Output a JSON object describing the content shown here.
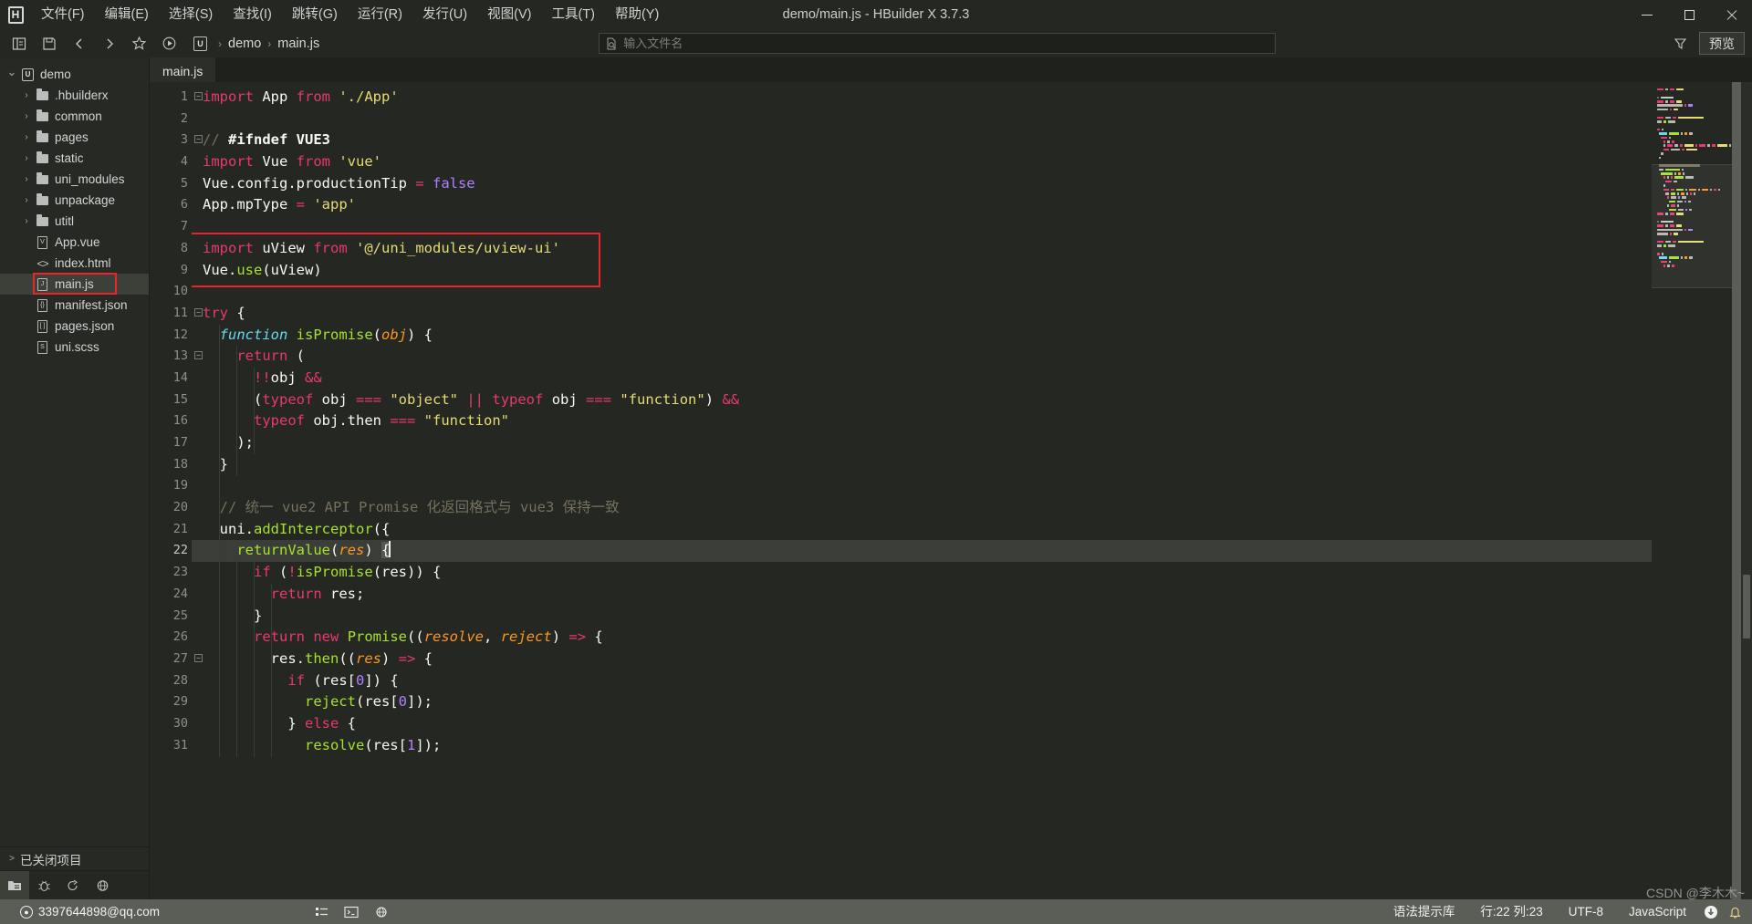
{
  "window": {
    "title": "demo/main.js - HBuilder X 3.7.3",
    "logo": "H",
    "minimize": "minimize-icon",
    "maximize": "maximize-icon",
    "close": "close-icon"
  },
  "menubar": [
    {
      "label": "文件(F)"
    },
    {
      "label": "编辑(E)"
    },
    {
      "label": "选择(S)"
    },
    {
      "label": "查找(I)"
    },
    {
      "label": "跳转(G)"
    },
    {
      "label": "运行(R)"
    },
    {
      "label": "发行(U)"
    },
    {
      "label": "视图(V)"
    },
    {
      "label": "工具(T)"
    },
    {
      "label": "帮助(Y)"
    }
  ],
  "toolbar": {
    "buttons": [
      "toggle-sidebar-icon",
      "save-icon",
      "back-icon",
      "forward-icon",
      "favorite-icon",
      "run-icon"
    ],
    "breadcrumb": {
      "project_badge": "U",
      "project": "demo",
      "separator": "›",
      "file": "main.js"
    },
    "search": {
      "placeholder": "输入文件名",
      "value": "",
      "icon": "file-search-icon"
    },
    "filter_icon": "filter-icon",
    "preview_label": "预览"
  },
  "sidebar": {
    "tree": [
      {
        "label": "demo",
        "indent": 0,
        "twisty": "v",
        "icon": "project-icon",
        "badge": "U",
        "selected": false
      },
      {
        "label": ".hbuilderx",
        "indent": 1,
        "twisty": ">",
        "icon": "folder-icon",
        "selected": false
      },
      {
        "label": "common",
        "indent": 1,
        "twisty": ">",
        "icon": "folder-icon",
        "selected": false
      },
      {
        "label": "pages",
        "indent": 1,
        "twisty": ">",
        "icon": "folder-icon",
        "selected": false
      },
      {
        "label": "static",
        "indent": 1,
        "twisty": ">",
        "icon": "folder-icon",
        "selected": false
      },
      {
        "label": "uni_modules",
        "indent": 1,
        "twisty": ">",
        "icon": "folder-icon",
        "selected": false
      },
      {
        "label": "unpackage",
        "indent": 1,
        "twisty": ">",
        "icon": "folder-icon",
        "selected": false
      },
      {
        "label": "utitl",
        "indent": 1,
        "twisty": ">",
        "icon": "folder-icon",
        "selected": false
      },
      {
        "label": "App.vue",
        "indent": 1,
        "twisty": "",
        "icon": "vue-file-icon",
        "badge": "V",
        "selected": false
      },
      {
        "label": "index.html",
        "indent": 1,
        "twisty": "",
        "icon": "html-file-icon",
        "badge": "<>",
        "selected": false
      },
      {
        "label": "main.js",
        "indent": 1,
        "twisty": "",
        "icon": "js-file-icon",
        "badge": "J",
        "selected": true,
        "highlighted": true
      },
      {
        "label": "manifest.json",
        "indent": 1,
        "twisty": "",
        "icon": "json-file-icon",
        "badge": "{}",
        "selected": false
      },
      {
        "label": "pages.json",
        "indent": 1,
        "twisty": "",
        "icon": "json-file-icon",
        "badge": "[ ]",
        "selected": false
      },
      {
        "label": "uni.scss",
        "indent": 1,
        "twisty": "",
        "icon": "scss-file-icon",
        "badge": "S",
        "selected": false
      }
    ],
    "closed_projects": {
      "label": "已关闭项目",
      "twisty": ">"
    },
    "bottom_tools": [
      "explorer-icon",
      "debug-icon",
      "share-icon",
      "network-icon"
    ]
  },
  "editor": {
    "tabs": [
      {
        "label": "main.js",
        "active": true
      }
    ],
    "current_line": 22,
    "first_line": 1,
    "red_highlight_lines": [
      8,
      9
    ],
    "lines": [
      {
        "n": 1,
        "fold": "-",
        "tokens": [
          {
            "t": "import",
            "c": "t-kw"
          },
          {
            "t": " App ",
            "c": "t-def"
          },
          {
            "t": "from",
            "c": "t-kw"
          },
          {
            "t": " ",
            "c": "t-def"
          },
          {
            "t": "'./App'",
            "c": "t-str"
          }
        ]
      },
      {
        "n": 2,
        "fold": "",
        "tokens": []
      },
      {
        "n": 3,
        "fold": "-",
        "tokens": [
          {
            "t": "// ",
            "c": "t-com"
          },
          {
            "t": "#ifndef VUE3",
            "c": "t-pp"
          }
        ]
      },
      {
        "n": 4,
        "fold": "",
        "tokens": [
          {
            "t": "import",
            "c": "t-kw"
          },
          {
            "t": " Vue ",
            "c": "t-def"
          },
          {
            "t": "from",
            "c": "t-kw"
          },
          {
            "t": " ",
            "c": "t-def"
          },
          {
            "t": "'vue'",
            "c": "t-str"
          }
        ]
      },
      {
        "n": 5,
        "fold": "",
        "tokens": [
          {
            "t": "Vue.config.productionTip ",
            "c": "t-def"
          },
          {
            "t": "=",
            "c": "t-op"
          },
          {
            "t": " ",
            "c": "t-def"
          },
          {
            "t": "false",
            "c": "t-const"
          }
        ]
      },
      {
        "n": 6,
        "fold": "",
        "tokens": [
          {
            "t": "App.mpType ",
            "c": "t-def"
          },
          {
            "t": "=",
            "c": "t-op"
          },
          {
            "t": " ",
            "c": "t-def"
          },
          {
            "t": "'app'",
            "c": "t-str"
          }
        ]
      },
      {
        "n": 7,
        "fold": "",
        "tokens": []
      },
      {
        "n": 8,
        "fold": "",
        "tokens": [
          {
            "t": "import",
            "c": "t-kw"
          },
          {
            "t": " uView ",
            "c": "t-def"
          },
          {
            "t": "from",
            "c": "t-kw"
          },
          {
            "t": " ",
            "c": "t-def"
          },
          {
            "t": "'@/uni_modules/uview-ui'",
            "c": "t-str"
          }
        ]
      },
      {
        "n": 9,
        "fold": "",
        "tokens": [
          {
            "t": "Vue.",
            "c": "t-def"
          },
          {
            "t": "use",
            "c": "t-fn"
          },
          {
            "t": "(uView)",
            "c": "t-def"
          }
        ]
      },
      {
        "n": 10,
        "fold": "",
        "tokens": []
      },
      {
        "n": 11,
        "fold": "-",
        "tokens": [
          {
            "t": "try",
            "c": "t-kw"
          },
          {
            "t": " {",
            "c": "t-def"
          }
        ]
      },
      {
        "n": 12,
        "fold": "",
        "tokens": [
          {
            "t": "  ",
            "c": "t-def"
          },
          {
            "t": "function",
            "c": "t-type"
          },
          {
            "t": " ",
            "c": "t-def"
          },
          {
            "t": "isPromise",
            "c": "t-fn"
          },
          {
            "t": "(",
            "c": "t-def"
          },
          {
            "t": "obj",
            "c": "t-param"
          },
          {
            "t": ") {",
            "c": "t-def"
          }
        ]
      },
      {
        "n": 13,
        "fold": "-",
        "tokens": [
          {
            "t": "    ",
            "c": "t-def"
          },
          {
            "t": "return",
            "c": "t-kw"
          },
          {
            "t": " (",
            "c": "t-def"
          }
        ]
      },
      {
        "n": 14,
        "fold": "",
        "tokens": [
          {
            "t": "      ",
            "c": "t-def"
          },
          {
            "t": "!!",
            "c": "t-op"
          },
          {
            "t": "obj ",
            "c": "t-def"
          },
          {
            "t": "&&",
            "c": "t-op"
          }
        ]
      },
      {
        "n": 15,
        "fold": "",
        "tokens": [
          {
            "t": "      (",
            "c": "t-def"
          },
          {
            "t": "typeof",
            "c": "t-op"
          },
          {
            "t": " obj ",
            "c": "t-def"
          },
          {
            "t": "===",
            "c": "t-op"
          },
          {
            "t": " ",
            "c": "t-def"
          },
          {
            "t": "\"object\"",
            "c": "t-str"
          },
          {
            "t": " ",
            "c": "t-def"
          },
          {
            "t": "||",
            "c": "t-op"
          },
          {
            "t": " ",
            "c": "t-def"
          },
          {
            "t": "typeof",
            "c": "t-op"
          },
          {
            "t": " obj ",
            "c": "t-def"
          },
          {
            "t": "===",
            "c": "t-op"
          },
          {
            "t": " ",
            "c": "t-def"
          },
          {
            "t": "\"function\"",
            "c": "t-str"
          },
          {
            "t": ") ",
            "c": "t-def"
          },
          {
            "t": "&&",
            "c": "t-op"
          }
        ]
      },
      {
        "n": 16,
        "fold": "",
        "tokens": [
          {
            "t": "      ",
            "c": "t-def"
          },
          {
            "t": "typeof",
            "c": "t-op"
          },
          {
            "t": " obj.then ",
            "c": "t-def"
          },
          {
            "t": "===",
            "c": "t-op"
          },
          {
            "t": " ",
            "c": "t-def"
          },
          {
            "t": "\"function\"",
            "c": "t-str"
          }
        ]
      },
      {
        "n": 17,
        "fold": "",
        "tokens": [
          {
            "t": "    );",
            "c": "t-def"
          }
        ]
      },
      {
        "n": 18,
        "fold": "",
        "tokens": [
          {
            "t": "  }",
            "c": "t-def"
          }
        ]
      },
      {
        "n": 19,
        "fold": "",
        "tokens": []
      },
      {
        "n": 20,
        "fold": "",
        "tokens": [
          {
            "t": "  // 统一 vue2 API Promise 化返回格式与 vue3 保持一致",
            "c": "t-com"
          }
        ]
      },
      {
        "n": 21,
        "fold": "",
        "tokens": [
          {
            "t": "  uni.",
            "c": "t-def"
          },
          {
            "t": "addInterceptor",
            "c": "t-fn"
          },
          {
            "t": "({",
            "c": "t-def"
          }
        ]
      },
      {
        "n": 22,
        "fold": "-",
        "tokens": [
          {
            "t": "    ",
            "c": "t-def"
          },
          {
            "t": "returnValue",
            "c": "t-fn"
          },
          {
            "t": "(",
            "c": "t-def"
          },
          {
            "t": "res",
            "c": "t-param"
          },
          {
            "t": ") ",
            "c": "t-def"
          }
        ],
        "caret_after_brace": true
      },
      {
        "n": 23,
        "fold": "",
        "tokens": [
          {
            "t": "      ",
            "c": "t-def"
          },
          {
            "t": "if",
            "c": "t-kw"
          },
          {
            "t": " (",
            "c": "t-def"
          },
          {
            "t": "!",
            "c": "t-op"
          },
          {
            "t": "isPromise",
            "c": "t-fn"
          },
          {
            "t": "(res)) {",
            "c": "t-def"
          }
        ]
      },
      {
        "n": 24,
        "fold": "",
        "tokens": [
          {
            "t": "        ",
            "c": "t-def"
          },
          {
            "t": "return",
            "c": "t-kw"
          },
          {
            "t": " res;",
            "c": "t-def"
          }
        ]
      },
      {
        "n": 25,
        "fold": "",
        "tokens": [
          {
            "t": "      }",
            "c": "t-def"
          }
        ]
      },
      {
        "n": 26,
        "fold": "",
        "tokens": [
          {
            "t": "      ",
            "c": "t-def"
          },
          {
            "t": "return",
            "c": "t-kw"
          },
          {
            "t": " ",
            "c": "t-def"
          },
          {
            "t": "new",
            "c": "t-kw"
          },
          {
            "t": " ",
            "c": "t-def"
          },
          {
            "t": "Promise",
            "c": "t-fn"
          },
          {
            "t": "((",
            "c": "t-def"
          },
          {
            "t": "resolve",
            "c": "t-param"
          },
          {
            "t": ", ",
            "c": "t-def"
          },
          {
            "t": "reject",
            "c": "t-param"
          },
          {
            "t": ") ",
            "c": "t-def"
          },
          {
            "t": "=>",
            "c": "t-op"
          },
          {
            "t": " {",
            "c": "t-def"
          }
        ]
      },
      {
        "n": 27,
        "fold": "-",
        "tokens": [
          {
            "t": "        res.",
            "c": "t-def"
          },
          {
            "t": "then",
            "c": "t-fn"
          },
          {
            "t": "((",
            "c": "t-def"
          },
          {
            "t": "res",
            "c": "t-param"
          },
          {
            "t": ") ",
            "c": "t-def"
          },
          {
            "t": "=>",
            "c": "t-op"
          },
          {
            "t": " {",
            "c": "t-def"
          }
        ]
      },
      {
        "n": 28,
        "fold": "",
        "tokens": [
          {
            "t": "          ",
            "c": "t-def"
          },
          {
            "t": "if",
            "c": "t-kw"
          },
          {
            "t": " (res[",
            "c": "t-def"
          },
          {
            "t": "0",
            "c": "t-num"
          },
          {
            "t": "]) {",
            "c": "t-def"
          }
        ]
      },
      {
        "n": 29,
        "fold": "",
        "tokens": [
          {
            "t": "            ",
            "c": "t-def"
          },
          {
            "t": "reject",
            "c": "t-fn"
          },
          {
            "t": "(res[",
            "c": "t-def"
          },
          {
            "t": "0",
            "c": "t-num"
          },
          {
            "t": "]);",
            "c": "t-def"
          }
        ]
      },
      {
        "n": 30,
        "fold": "",
        "tokens": [
          {
            "t": "          } ",
            "c": "t-def"
          },
          {
            "t": "else",
            "c": "t-kw"
          },
          {
            "t": " {",
            "c": "t-def"
          }
        ]
      },
      {
        "n": 31,
        "fold": "",
        "tokens": [
          {
            "t": "            ",
            "c": "t-def"
          },
          {
            "t": "resolve",
            "c": "t-fn"
          },
          {
            "t": "(res[",
            "c": "t-def"
          },
          {
            "t": "1",
            "c": "t-num"
          },
          {
            "t": "]);",
            "c": "t-def"
          }
        ]
      }
    ]
  },
  "statusbar": {
    "account": "3397644898@qq.com",
    "icons_left": [
      "list-icon",
      "terminal-icon",
      "globe-icon"
    ],
    "items": [
      {
        "label": "语法提示库"
      },
      {
        "label": "行:22  列:23"
      },
      {
        "label": "UTF-8"
      },
      {
        "label": "JavaScript"
      }
    ],
    "download_icon": "download-icon",
    "bell_icon": "bell-icon",
    "watermark": "CSDN @李木木~"
  },
  "colors": {
    "accent_red": "#e8252a",
    "statusbar_bg": "#5b5e56",
    "editor_bg": "#252722",
    "keyword": "#e8396f",
    "string": "#e6db74",
    "function": "#a6e22e",
    "comment": "#75715e",
    "number": "#ae81ff",
    "param": "#fd971f",
    "type": "#66d9ef"
  }
}
